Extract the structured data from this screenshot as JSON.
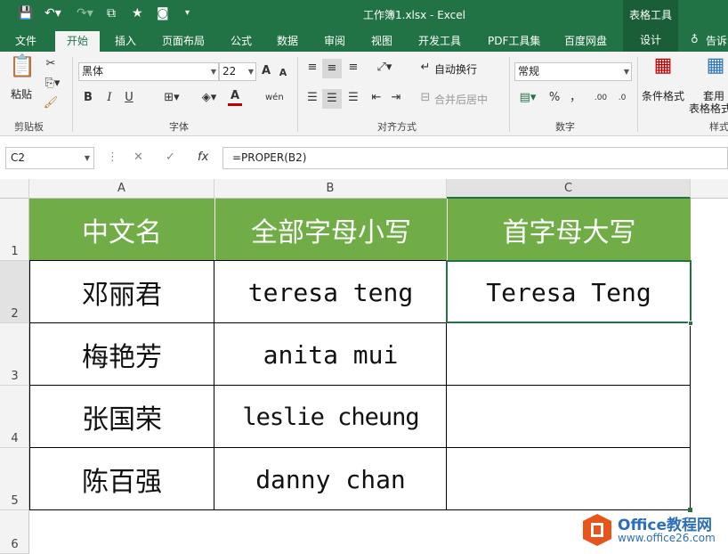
{
  "window": {
    "title": "工作簿1.xlsx - Excel",
    "context_tab_group": "表格工具",
    "colors": {
      "brand": "#217346",
      "header_fill": "#70ad47"
    }
  },
  "tabs": [
    "文件",
    "开始",
    "插入",
    "页面布局",
    "公式",
    "数据",
    "审阅",
    "视图",
    "开发工具",
    "PDF工具集",
    "百度网盘",
    "设计"
  ],
  "tell_me": "告诉",
  "ribbon": {
    "clipboard": {
      "paste": "粘贴",
      "label": "剪贴板"
    },
    "font": {
      "name": "黑体",
      "size": "22",
      "bold": "B",
      "italic": "I",
      "underline": "U",
      "label": "字体"
    },
    "alignment": {
      "wrap": "自动换行",
      "merge": "合并后居中",
      "label": "对齐方式"
    },
    "number": {
      "format": "常规",
      "percent": "%",
      "comma": "，",
      "label": "数字"
    },
    "styles": {
      "conditional": "条件格式",
      "table_format_1": "套用",
      "table_format_2": "表格格式",
      "label": "样式"
    }
  },
  "formula_bar": {
    "name_box": "C2",
    "fx": "fx",
    "formula": "=PROPER(B2)"
  },
  "columns": [
    "A",
    "B",
    "C"
  ],
  "rows": [
    "1",
    "2",
    "3",
    "4",
    "5",
    "6"
  ],
  "table": {
    "headers": [
      "中文名",
      "全部字母小写",
      "首字母大写"
    ],
    "rows": [
      [
        "邓丽君",
        "teresa teng",
        "Teresa Teng"
      ],
      [
        "梅艳芳",
        "anita mui",
        ""
      ],
      [
        "张国荣",
        "leslie cheung",
        ""
      ],
      [
        "陈百强",
        "danny chan",
        ""
      ]
    ]
  },
  "watermark": {
    "brand": "Office教程网",
    "url": "www.office26.com"
  }
}
